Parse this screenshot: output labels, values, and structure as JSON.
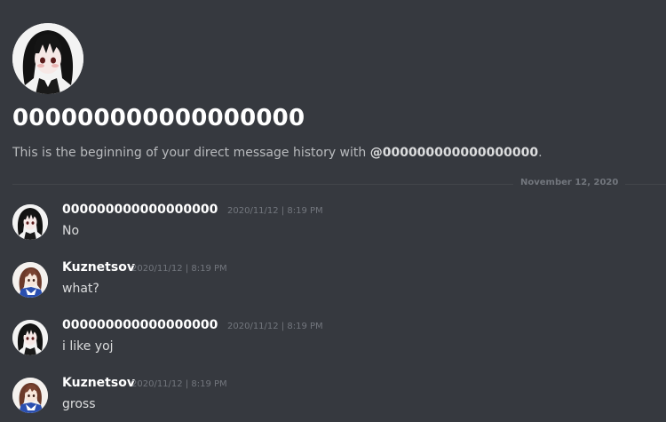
{
  "header": {
    "avatar_icon": "goth-girl-avatar-icon",
    "title": "000000000000000000",
    "intro_text": "This is the beginning of your direct message history with ",
    "intro_mention": "@000000000000000000",
    "intro_end": "."
  },
  "divider": {
    "date": "November 12, 2020"
  },
  "messages": [
    {
      "username": "000000000000000000",
      "timestamp": "2020/11/12 | 8:19 PM",
      "content": "No",
      "avatar_icon": "goth-girl-avatar-icon"
    },
    {
      "username": "Kuznetsov",
      "timestamp": "2020/11/12 | 8:19 PM",
      "content": "what?",
      "avatar_icon": "anime-girl-avatar-icon"
    },
    {
      "username": "000000000000000000",
      "timestamp": "2020/11/12 | 8:19 PM",
      "content": "i like yoj",
      "avatar_icon": "goth-girl-avatar-icon"
    },
    {
      "username": "Kuznetsov",
      "timestamp": "2020/11/12 | 8:19 PM",
      "content": "gross",
      "avatar_icon": "anime-girl-avatar-icon"
    }
  ],
  "colors": {
    "background": "#36393f",
    "username": "#ffffff",
    "timestamp": "#72767d",
    "text": "#dcddde",
    "muted": "#b9bbbe"
  }
}
